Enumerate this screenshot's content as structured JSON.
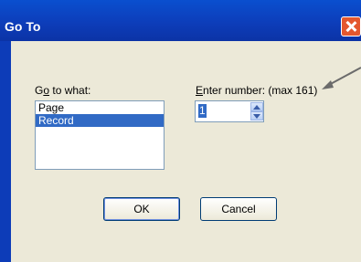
{
  "window": {
    "title": "Go To"
  },
  "goto_what": {
    "label_prefix": "G",
    "label_underline": "o",
    "label_suffix": " to what:",
    "items": [
      {
        "label": "Page",
        "selected": false
      },
      {
        "label": "Record",
        "selected": true
      }
    ]
  },
  "enter_number": {
    "label_underline": "E",
    "label_suffix": "nter number: (max 161)",
    "value": "1"
  },
  "buttons": {
    "ok_label": "OK",
    "cancel_label": "Cancel"
  },
  "colors": {
    "titlebar": "#0d3cb8",
    "dialog_background": "#ece9d8",
    "selection": "#316ac5",
    "close_button": "#e4572e"
  }
}
